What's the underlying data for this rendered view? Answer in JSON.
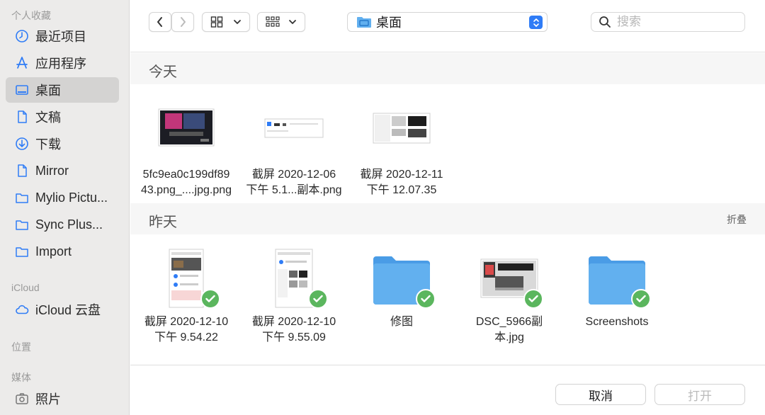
{
  "sidebar": {
    "favorites_title": "个人收藏",
    "favorites": [
      {
        "label": "最近项目",
        "icon": "clock-icon"
      },
      {
        "label": "应用程序",
        "icon": "apps-icon"
      },
      {
        "label": "桌面",
        "icon": "desktop-icon"
      },
      {
        "label": "文稿",
        "icon": "document-icon"
      },
      {
        "label": "下载",
        "icon": "download-icon"
      },
      {
        "label": "Mirror",
        "icon": "document-icon"
      },
      {
        "label": "Mylio Pictu...",
        "icon": "folder-icon"
      },
      {
        "label": "Sync Plus...",
        "icon": "folder-icon"
      },
      {
        "label": "Import",
        "icon": "folder-icon"
      }
    ],
    "icloud_title": "iCloud",
    "icloud_drive": "iCloud 云盘",
    "locations_title": "位置",
    "media_title": "媒体",
    "photos": "照片"
  },
  "toolbar": {
    "path": "桌面",
    "search_placeholder": "搜索"
  },
  "sections": {
    "today": {
      "label": "今天"
    },
    "yesterday": {
      "label": "昨天",
      "collapse": "折叠"
    }
  },
  "today_files": [
    {
      "line1": "5fc9ea0c199df89",
      "line2": "43.png_....jpg.png"
    },
    {
      "line1": "截屏 2020-12-06",
      "line2": "下午 5.1...副本.png"
    },
    {
      "line1": "截屏 2020-12-11",
      "line2": "下午 12.07.35"
    }
  ],
  "yesterday_files": [
    {
      "line1": "截屏 2020-12-10",
      "line2": "下午 9.54.22"
    },
    {
      "line1": "截屏 2020-12-10",
      "line2": "下午 9.55.09"
    },
    {
      "line1": "修图",
      "line2": ""
    },
    {
      "line1": "DSC_5966副",
      "line2": "本.jpg"
    },
    {
      "line1": "Screenshots",
      "line2": ""
    }
  ],
  "footer": {
    "cancel": "取消",
    "open": "打开"
  },
  "colors": {
    "accent": "#2f7cf6",
    "check": "#5bb65e",
    "folder": "#62b0ef"
  }
}
